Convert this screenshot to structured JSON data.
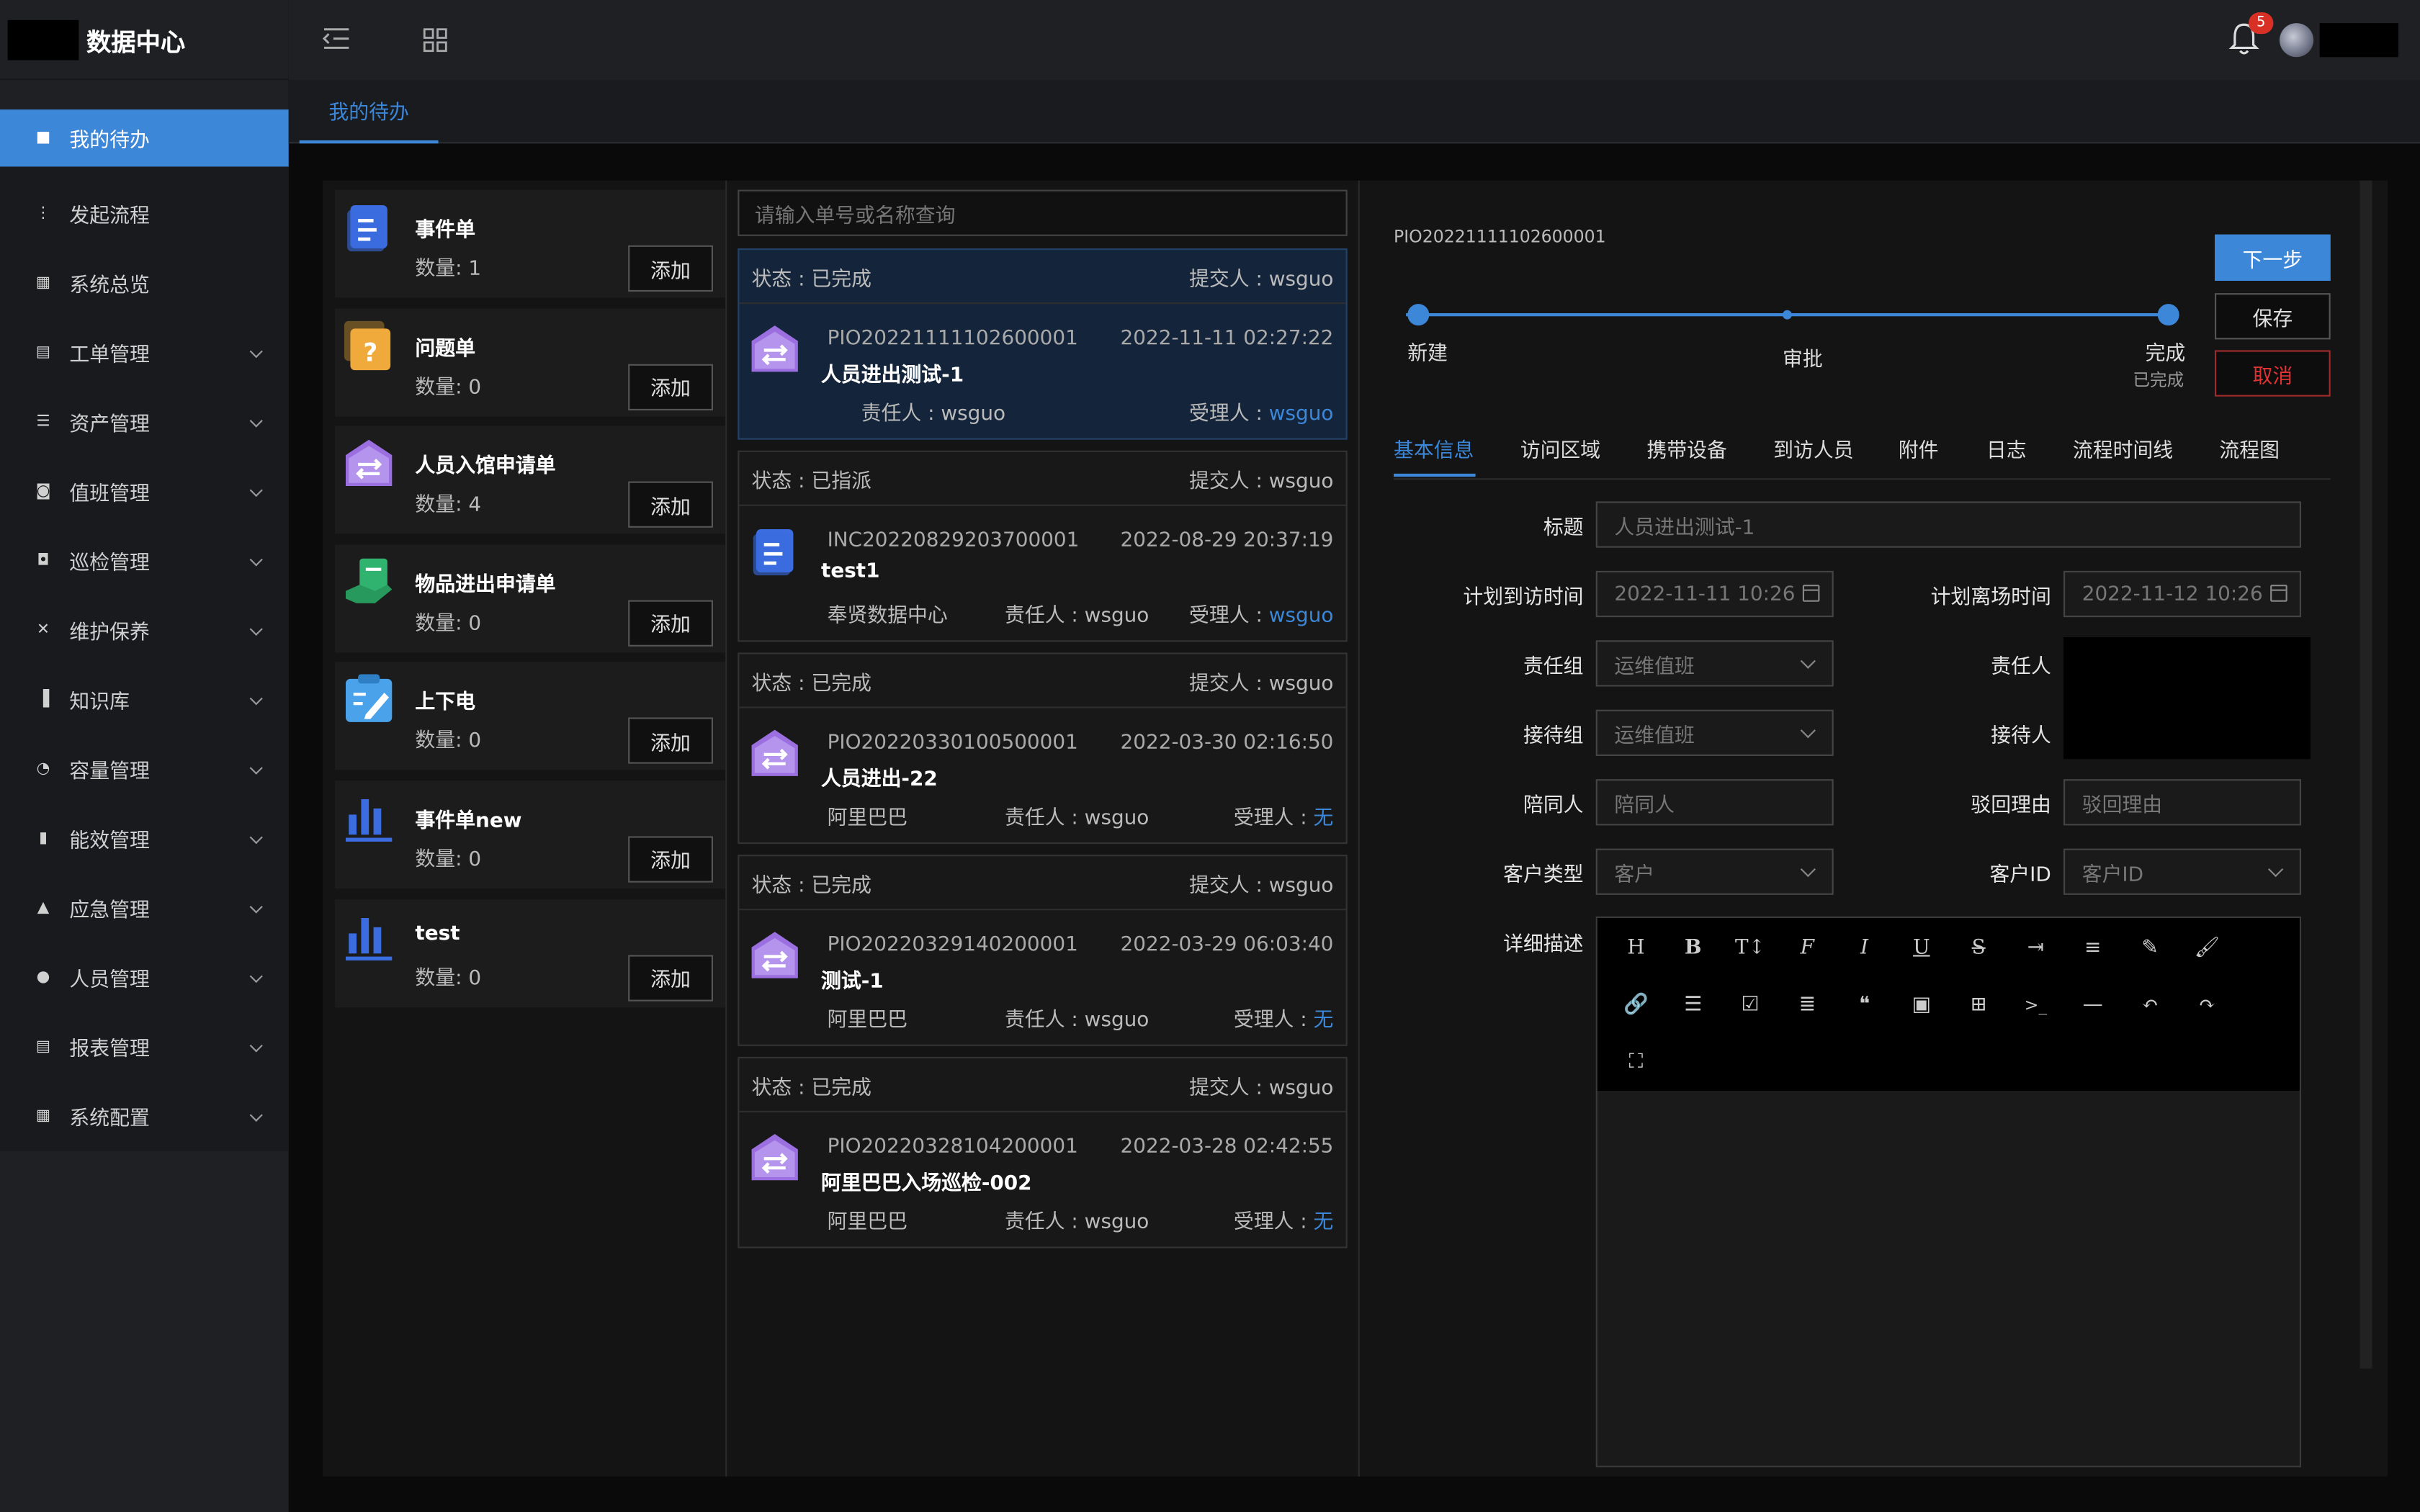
{
  "app": {
    "title": "数据中心",
    "notif_count": "5"
  },
  "sidebar": {
    "items": [
      {
        "label": "我的待办",
        "icon": "todo-icon"
      },
      {
        "label": "发起流程",
        "icon": "flow-icon"
      },
      {
        "label": "系统总览",
        "icon": "grid-icon"
      },
      {
        "label": "工单管理",
        "icon": "ticket-icon"
      },
      {
        "label": "资产管理",
        "icon": "asset-icon"
      },
      {
        "label": "值班管理",
        "icon": "duty-icon"
      },
      {
        "label": "巡检管理",
        "icon": "inspect-icon"
      },
      {
        "label": "维护保养",
        "icon": "tools-icon"
      },
      {
        "label": "知识库",
        "icon": "book-icon"
      },
      {
        "label": "容量管理",
        "icon": "pie-icon"
      },
      {
        "label": "能效管理",
        "icon": "bars-icon"
      },
      {
        "label": "应急管理",
        "icon": "warning-icon"
      },
      {
        "label": "人员管理",
        "icon": "user-icon"
      },
      {
        "label": "报表管理",
        "icon": "report-icon"
      },
      {
        "label": "系统配置",
        "icon": "config-icon"
      }
    ]
  },
  "tabs": {
    "active": "我的待办"
  },
  "types": {
    "count_prefix": "数量:",
    "add_label": "添加",
    "items": [
      {
        "name": "事件单",
        "count": "1",
        "icon": "doc-icon",
        "color": "#3b6de0"
      },
      {
        "name": "问题单",
        "count": "0",
        "icon": "question-icon",
        "color": "#f0a93b"
      },
      {
        "name": "人员入馆申请单",
        "count": "4",
        "icon": "transfer-icon",
        "color": "#9b6fe0"
      },
      {
        "name": "物品进出申请单",
        "count": "0",
        "icon": "hand-doc-icon",
        "color": "#2fb36e"
      },
      {
        "name": "上下电",
        "count": "0",
        "icon": "clipboard-icon",
        "color": "#4aa3ea"
      },
      {
        "name": "事件单new",
        "count": "0",
        "icon": "bar-chart-icon",
        "color": "#3b6de0"
      },
      {
        "name": "test",
        "count": "0",
        "icon": "bar-chart-icon",
        "color": "#3b6de0"
      }
    ]
  },
  "list": {
    "search_placeholder": "请输入单号或名称查询",
    "items": [
      {
        "status": "状态 : 已完成",
        "submitter": "提交人 : wsguo",
        "no": "PIO20221111102600001",
        "datetime": "2022-11-11 02:27:22",
        "title": "人员进出测试-1",
        "location": "",
        "owner": "责任人 : wsguo",
        "assignee_prefix": "受理人 : ",
        "assignee": "wsguo"
      },
      {
        "status": "状态 : 已指派",
        "submitter": "提交人 : wsguo",
        "no": "INC20220829203700001",
        "datetime": "2022-08-29 20:37:19",
        "title": "test1",
        "location": "奉贤数据中心",
        "owner": "责任人 : wsguo",
        "assignee_prefix": "受理人 : ",
        "assignee": "wsguo"
      },
      {
        "status": "状态 : 已完成",
        "submitter": "提交人 : wsguo",
        "no": "PIO20220330100500001",
        "datetime": "2022-03-30 02:16:50",
        "title": "人员进出-22",
        "location": "阿里巴巴",
        "owner": "责任人 : wsguo",
        "assignee_prefix": "受理人 : ",
        "assignee": "无"
      },
      {
        "status": "状态 : 已完成",
        "submitter": "提交人 : wsguo",
        "no": "PIO20220329140200001",
        "datetime": "2022-03-29 06:03:40",
        "title": "测试-1",
        "location": "阿里巴巴",
        "owner": "责任人 : wsguo",
        "assignee_prefix": "受理人 : ",
        "assignee": "无"
      },
      {
        "status": "状态 : 已完成",
        "submitter": "提交人 : wsguo",
        "no": "PIO20220328104200001",
        "datetime": "2022-03-28 02:42:55",
        "title": "阿里巴巴入场巡检-002",
        "location": "阿里巴巴",
        "owner": "责任人 : wsguo",
        "assignee_prefix": "受理人 : ",
        "assignee": "无"
      }
    ]
  },
  "detail": {
    "no": "PIO20221111102600001",
    "buttons": {
      "next": "下一步",
      "save": "保存",
      "cancel": "取消"
    },
    "steps": {
      "s1": "新建",
      "s2": "审批",
      "s3": "完成",
      "s3_sub": "已完成"
    },
    "tabs": [
      "基本信息",
      "访问区域",
      "携带设备",
      "到访人员",
      "附件",
      "日志",
      "流程时间线",
      "流程图"
    ],
    "fields": {
      "title_label": "标题",
      "title_value": "人员进出测试-1",
      "visit_start_label": "计划到访时间",
      "visit_start_value": "2022-11-11 10:26",
      "visit_end_label": "计划离场时间",
      "visit_end_value": "2022-11-12 10:26",
      "group_label": "责任组",
      "group_value": "运维值班",
      "owner_label": "责任人",
      "host_group_label": "接待组",
      "host_group_value": "运维值班",
      "host_label": "接待人",
      "companion_label": "陪同人",
      "companion_placeholder": "陪同人",
      "reject_label": "驳回理由",
      "reject_placeholder": "驳回理由",
      "cust_type_label": "客户类型",
      "cust_type_placeholder": "客户",
      "cust_id_label": "客户ID",
      "cust_id_placeholder": "客户ID",
      "desc_label": "详细描述"
    }
  }
}
